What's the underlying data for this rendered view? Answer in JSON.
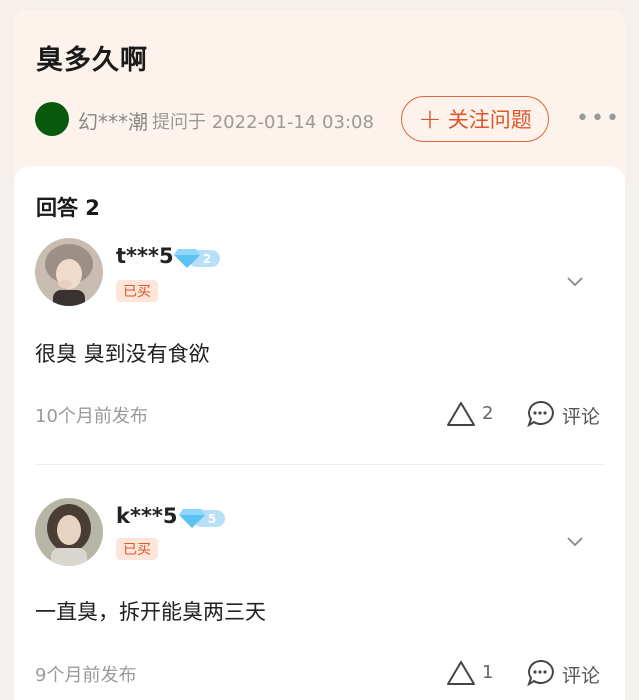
{
  "question": {
    "title": "臭多久啊",
    "asker": "幻***潮",
    "asked_time": "提问于 2022-01-14 03:08",
    "follow_label": "关注问题",
    "asker_avatar_color": "#0a5a0e"
  },
  "answers_header": "回答 2",
  "answers": [
    {
      "user": "t***5",
      "level": "2",
      "tag": "已买",
      "text": "很臭 臭到没有食欲",
      "time": "10个月前发布",
      "likes": "2",
      "comment_label": "评论"
    },
    {
      "user": "k***5",
      "level": "5",
      "tag": "已买",
      "text": "一直臭，拆开能臭两三天",
      "time": "9个月前发布",
      "likes": "1",
      "comment_label": "评论"
    }
  ],
  "colors": {
    "accent": "#e0562a",
    "header_bg": "#fdf3ec",
    "tag_bg": "#fde5da",
    "level_badge": "#b7e0f8"
  }
}
